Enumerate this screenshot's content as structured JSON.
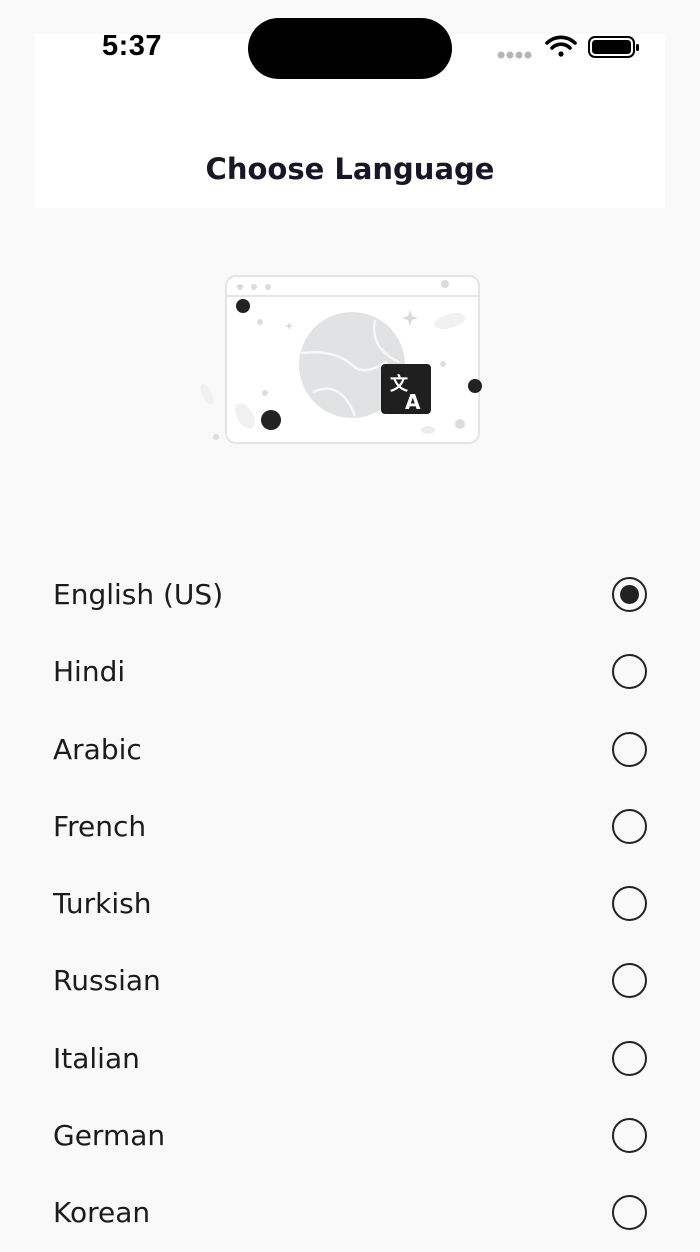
{
  "status_bar": {
    "time": "5:37"
  },
  "header": {
    "title": "Choose Language"
  },
  "illustration": {
    "icon": "translate-icon"
  },
  "languages": [
    {
      "label": "English (US)",
      "selected": true
    },
    {
      "label": "Hindi",
      "selected": false
    },
    {
      "label": "Arabic",
      "selected": false
    },
    {
      "label": "French",
      "selected": false
    },
    {
      "label": "Turkish",
      "selected": false
    },
    {
      "label": "Russian",
      "selected": false
    },
    {
      "label": "Italian",
      "selected": false
    },
    {
      "label": "German",
      "selected": false
    },
    {
      "label": "Korean",
      "selected": false
    }
  ]
}
